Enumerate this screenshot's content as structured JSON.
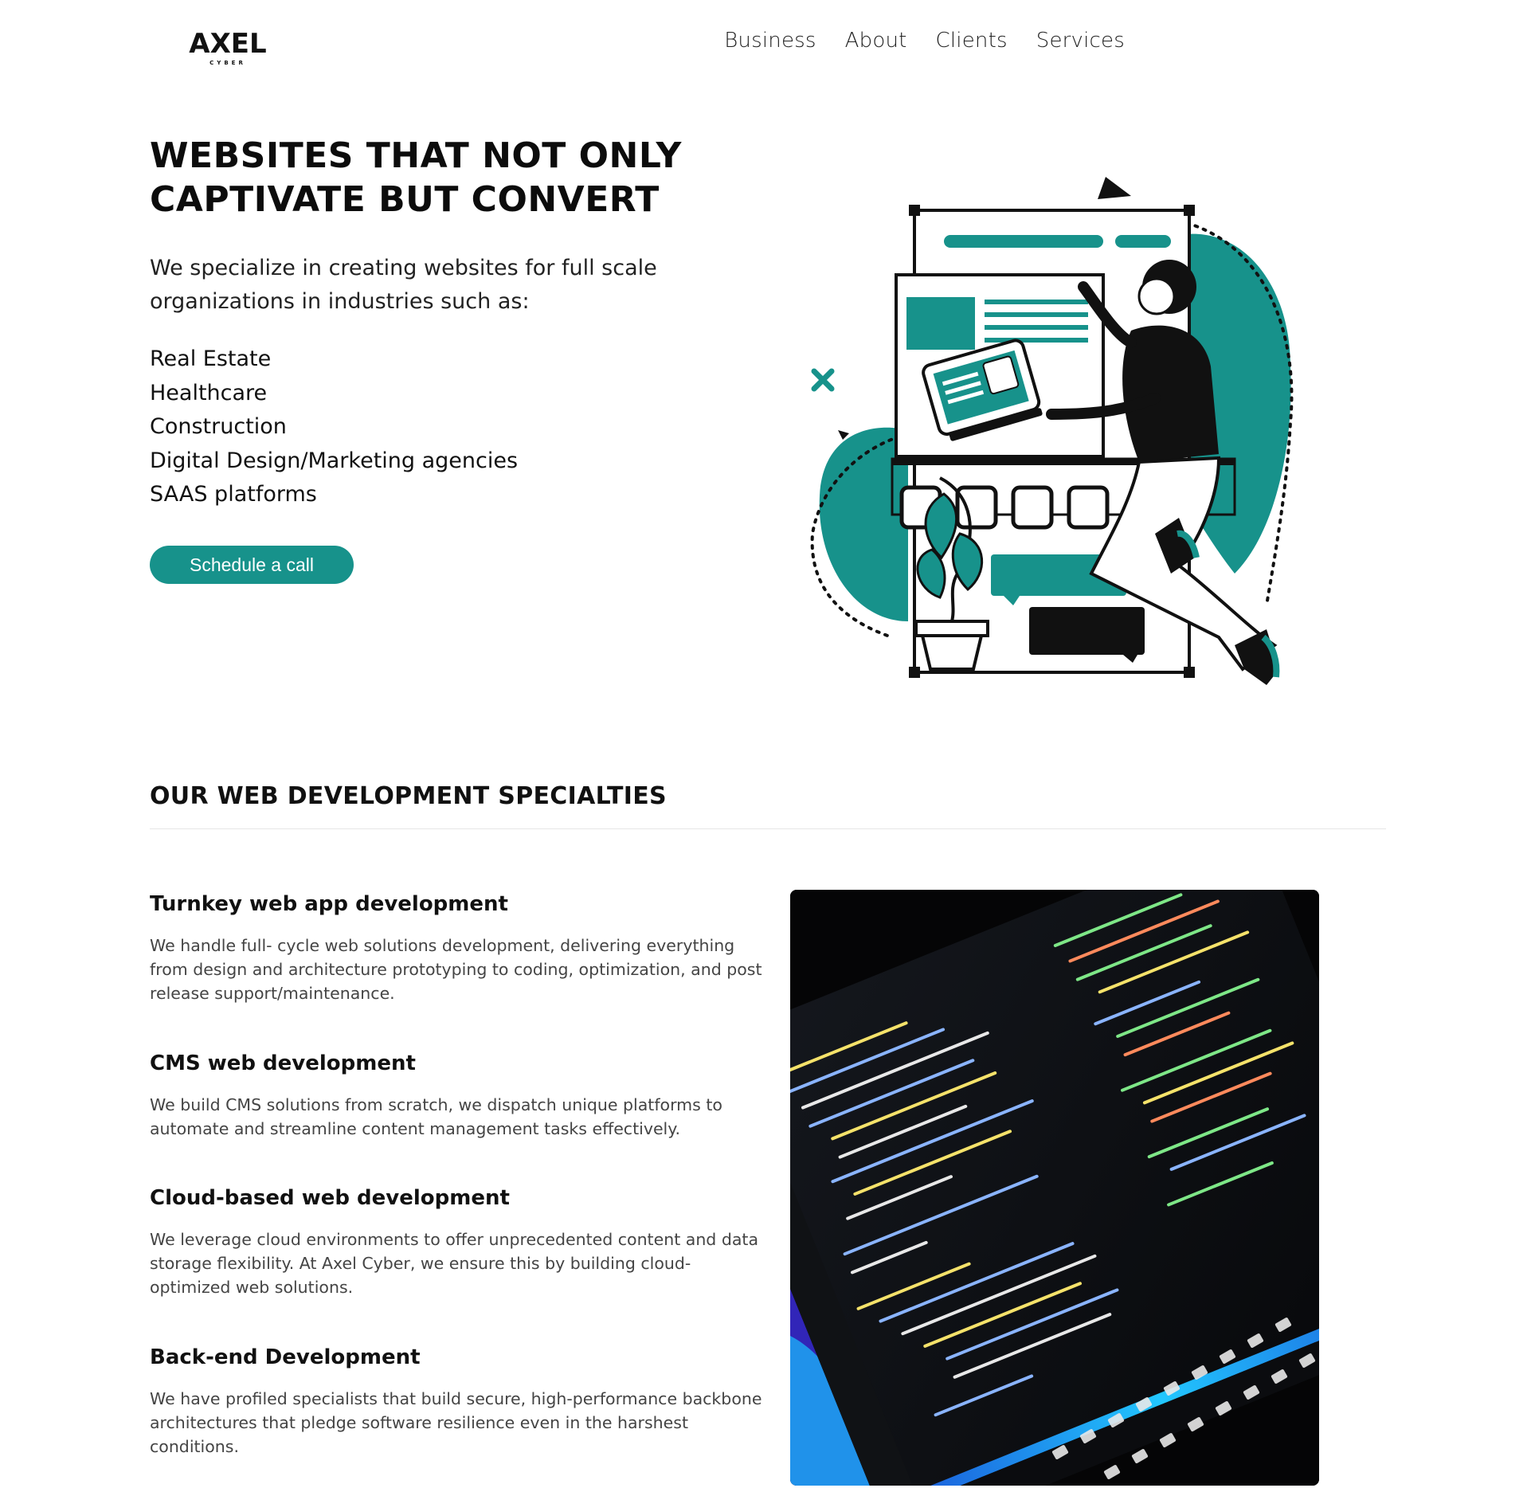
{
  "brand": {
    "logo_text": "AXEL",
    "logo_subtext": "CYBER"
  },
  "nav": {
    "items": [
      "Business",
      "About",
      "Clients",
      "Services"
    ]
  },
  "hero": {
    "title_line1": "WEBSITES THAT NOT ONLY",
    "title_line2": "CAPTIVATE BUT CONVERT",
    "intro": "We specialize in creating websites for full scale organizations in industries such as:",
    "industries": [
      "Real Estate",
      "Healthcare",
      "Construction",
      "Digital Design/Marketing agencies",
      "SAAS platforms"
    ],
    "cta_label": "Schedule a call"
  },
  "specialties": {
    "title": "OUR WEB DEVELOPMENT SPECIALTIES",
    "items": [
      {
        "title": "Turnkey web app development",
        "body": "We handle full- cycle web solutions development, delivering everything from design and architecture prototyping to coding, optimization, and post release support/maintenance."
      },
      {
        "title": "CMS web development",
        "body": "We build CMS solutions from scratch, we dispatch unique platforms to automate and streamline content management tasks effectively."
      },
      {
        "title": "Cloud-based web development",
        "body": "We leverage cloud environments to offer unprecedented content and data storage flexibility. At Axel Cyber, we ensure this by building cloud-optimized web solutions."
      },
      {
        "title": "Back-end Development",
        "body": "We have profiled specialists that build secure, high-performance backbone architectures that pledge software resilience even in the harshest conditions."
      }
    ]
  },
  "colors": {
    "accent": "#17928b",
    "text": "#111111",
    "muted": "#444444"
  },
  "icons": {
    "hero": "web-design-illustration",
    "photo": "laptop-code-photo"
  }
}
